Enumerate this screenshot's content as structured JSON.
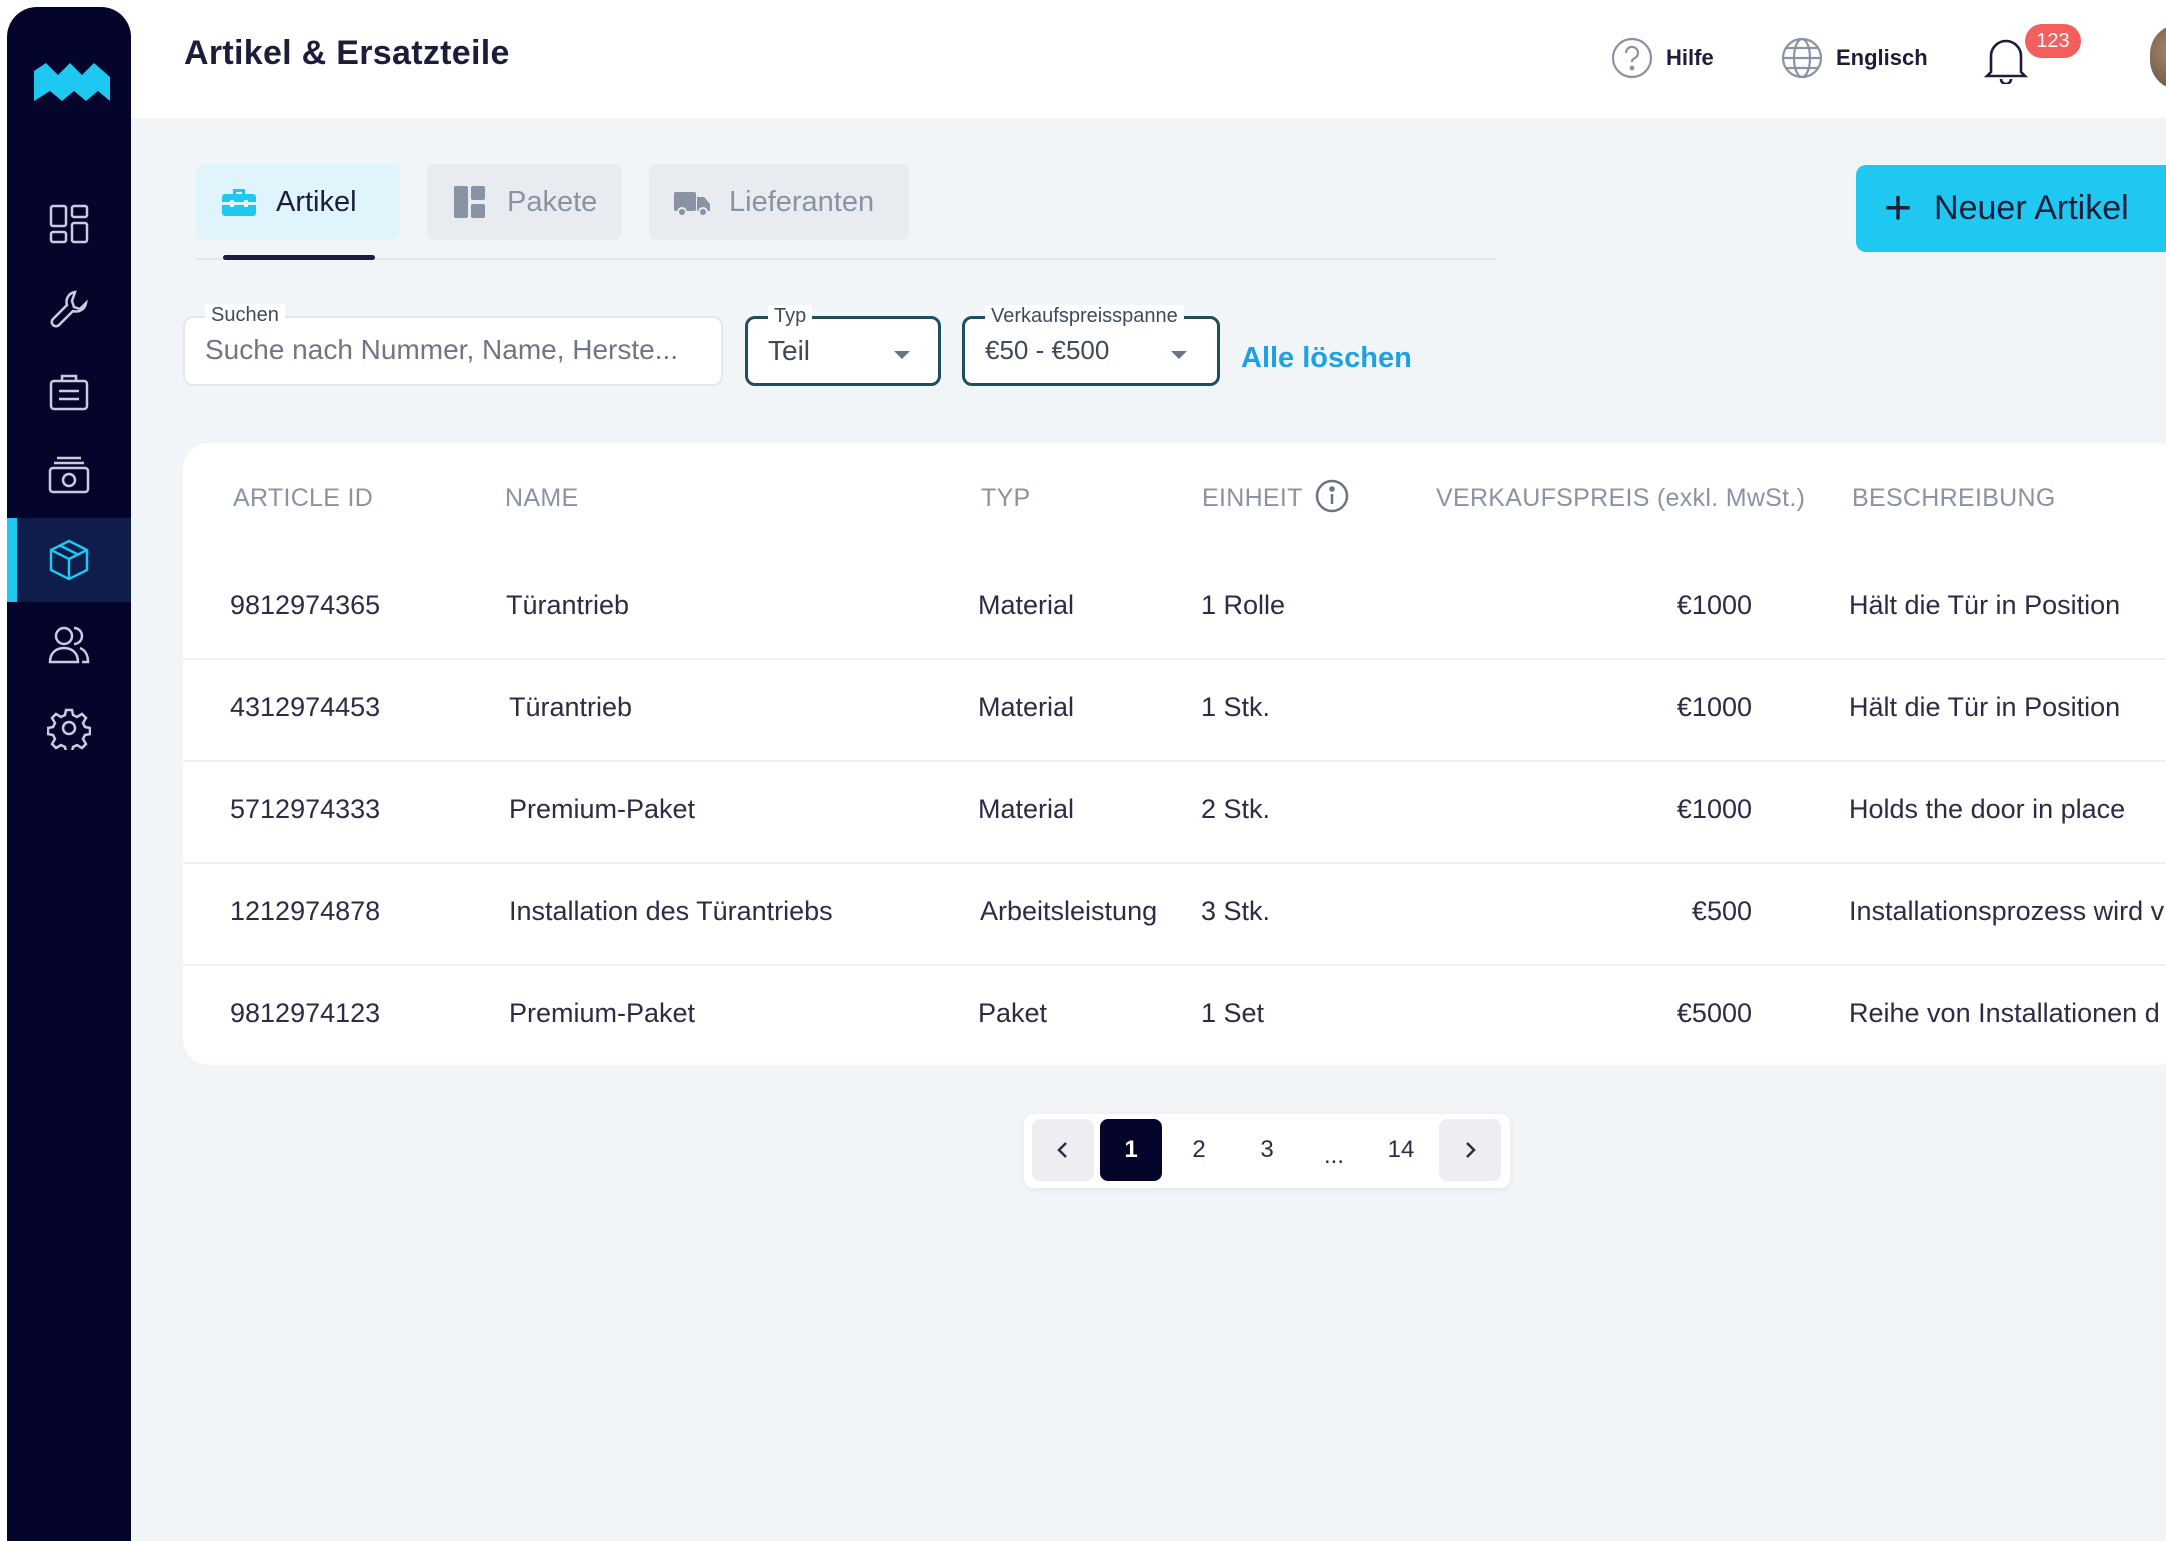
{
  "header": {
    "title": "Artikel & Ersatzteile",
    "help_label": "Hilfe",
    "language_label": "Englisch",
    "notification_count": "123"
  },
  "tabs": [
    {
      "label": "Artikel",
      "icon": "toolbox-icon",
      "active": true
    },
    {
      "label": "Pakete",
      "icon": "layout-icon",
      "active": false
    },
    {
      "label": "Lieferanten",
      "icon": "truck-icon",
      "active": false
    }
  ],
  "new_button": {
    "label": "Neuer Artikel"
  },
  "filters": {
    "search": {
      "label": "Suchen",
      "placeholder": "Suche nach Nummer, Name, Herste..."
    },
    "typ": {
      "label": "Typ",
      "value": "Teil"
    },
    "preis": {
      "label": "Verkaufspreisspanne",
      "value": "€50 - €500"
    },
    "clear_label": "Alle löschen"
  },
  "table": {
    "headers": {
      "id": "ARTICLE ID",
      "name": "NAME",
      "typ": "TYP",
      "einheit": "EINHEIT",
      "preis": "VERKAUFSPREIS (exkl. MwSt.)",
      "beschreibung": "BESCHREIBUNG"
    },
    "rows": [
      {
        "id": "9812974365",
        "name": "Türantrieb",
        "typ": "Material",
        "einheit": "1 Rolle",
        "preis": "€1000",
        "beschreibung": "Hält die Tür in Position"
      },
      {
        "id": "4312974453",
        "name": "Türantrieb",
        "typ": "Material",
        "einheit": "1 Stk.",
        "preis": "€1000",
        "beschreibung": "Hält die Tür in Position"
      },
      {
        "id": "5712974333",
        "name": "Premium-Paket",
        "typ": "Material",
        "einheit": "2 Stk.",
        "preis": "€1000",
        "beschreibung": "Holds the door in place"
      },
      {
        "id": "1212974878",
        "name": "Installation des Türantriebs",
        "typ": "Arbeitsleistung",
        "einheit": "3 Stk.",
        "preis": "€500",
        "beschreibung": "Installationsprozess wird v"
      },
      {
        "id": "9812974123",
        "name": "Premium-Paket",
        "typ": "Paket",
        "einheit": "1 Set",
        "preis": "€5000",
        "beschreibung": "Reihe von Installationen d"
      }
    ]
  },
  "pagination": {
    "pages": [
      "1",
      "2",
      "3",
      "...",
      "14"
    ],
    "current": "1"
  },
  "sidebar": {
    "items": [
      {
        "name": "dashboard-icon",
        "active": false
      },
      {
        "name": "wrench-icon",
        "active": false
      },
      {
        "name": "briefcase-icon",
        "active": false
      },
      {
        "name": "money-icon",
        "active": false
      },
      {
        "name": "box-icon",
        "active": true
      },
      {
        "name": "users-icon",
        "active": false
      },
      {
        "name": "gear-icon",
        "active": false
      }
    ]
  },
  "colors": {
    "sidebar_bg": "#05052b",
    "accent": "#1ec8f0",
    "link": "#1ba2e4",
    "badge": "#f25f5c"
  }
}
